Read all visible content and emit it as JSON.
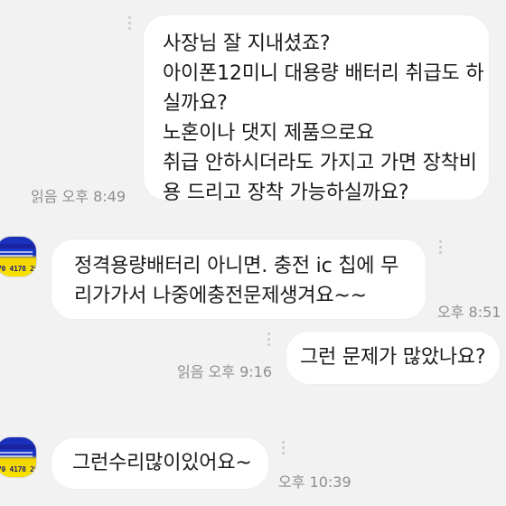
{
  "messages": [
    {
      "side": "sent",
      "lines": [
        "사장님 잘 지내셨죠?",
        "아이폰12미니 대용량 배터리 취급도 하",
        "실까요?",
        "노혼이나 댓지 제품으로요",
        "취급 안하시더라도 가지고 가면 장착비",
        "용 드리고 장착 가능하실까요?"
      ],
      "read_label": "읽음",
      "time": "오후 8:49"
    },
    {
      "side": "received",
      "lines": [
        "정격용량배터리 아니면. 충전 ic 칩에 무",
        "리가가서 나중에충전문제생겨요~~"
      ],
      "time": "오후 8:51"
    },
    {
      "side": "sent",
      "lines": [
        "그런 문제가 많았나요?"
      ],
      "read_label": "읽음",
      "time": "오후 9:16"
    },
    {
      "side": "received",
      "lines": [
        "그런수리많이있어요~"
      ],
      "time": "오후 10:39"
    }
  ],
  "avatar": {
    "name": "sender-profile",
    "phone_fragment": "70 4178 2077",
    "colors": [
      "#1b2fb8",
      "#f2d400"
    ]
  }
}
